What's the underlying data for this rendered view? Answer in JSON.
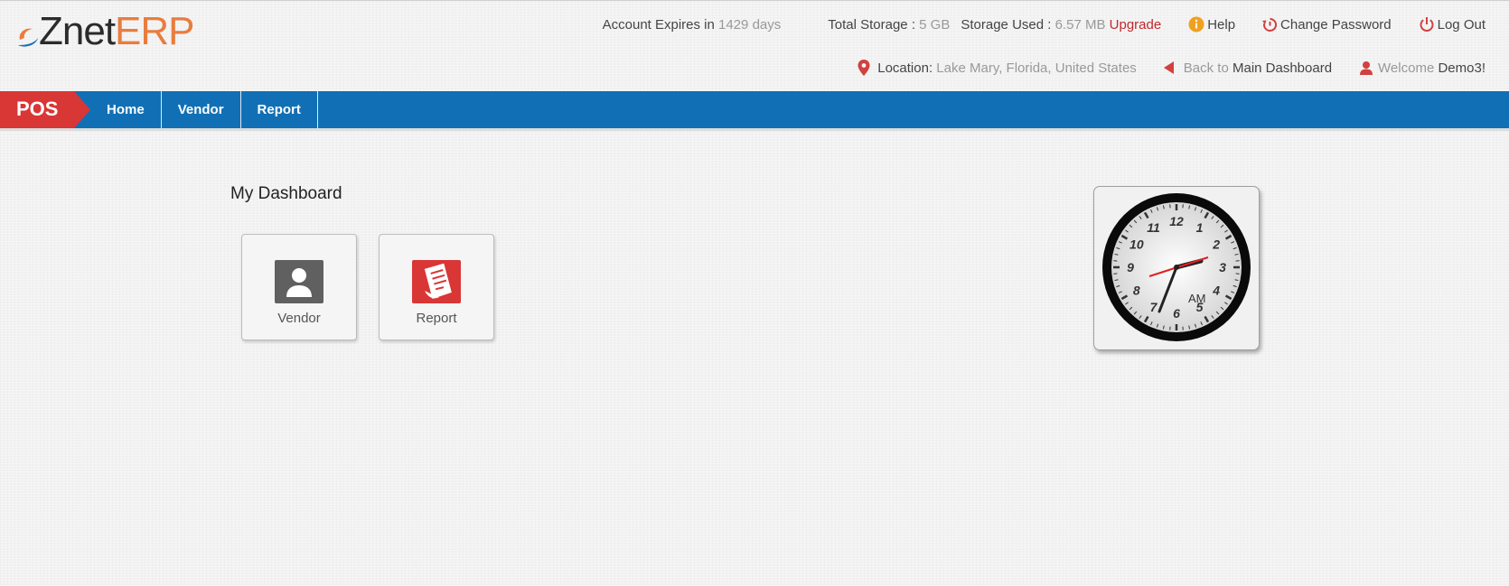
{
  "logo": {
    "part1": "Znet",
    "part2": "ERP"
  },
  "account": {
    "expires_label": "Account Expires in",
    "expires_value": "1429 days"
  },
  "storage": {
    "total_label": "Total Storage :",
    "total_value": "5 GB",
    "used_label": "Storage Used :",
    "used_value": "6.57 MB",
    "upgrade_label": "Upgrade"
  },
  "links": {
    "help": "Help",
    "change_password": "Change Password",
    "logout": "Log Out"
  },
  "location": {
    "label": "Location:",
    "value": "Lake Mary, Florida, United States"
  },
  "back": {
    "label": "Back to",
    "target": "Main Dashboard"
  },
  "welcome": {
    "label": "Welcome",
    "user": "Demo3!"
  },
  "nav": {
    "module": "POS",
    "items": [
      "Home",
      "Vendor",
      "Report"
    ]
  },
  "dashboard": {
    "title": "My Dashboard",
    "tiles": [
      {
        "label": "Vendor",
        "icon": "user-icon"
      },
      {
        "label": "Report",
        "icon": "report-icon"
      }
    ]
  },
  "clock": {
    "meridiem": "AM",
    "numbers": [
      "12",
      "1",
      "2",
      "3",
      "4",
      "5",
      "6",
      "7",
      "8",
      "9",
      "10",
      "11"
    ]
  },
  "colors": {
    "nav_blue": "#1170b5",
    "pos_red": "#d93636",
    "brand_orange": "#e87d3e",
    "upgrade_red": "#c0282d"
  }
}
